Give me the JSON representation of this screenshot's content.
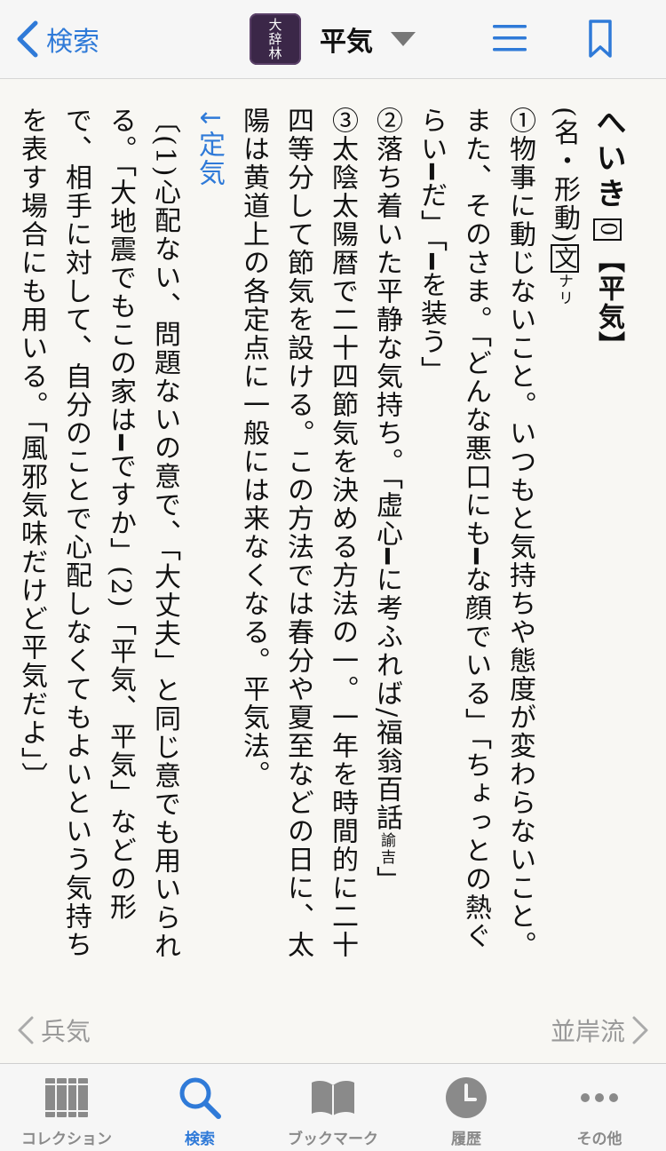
{
  "header": {
    "back_label": "検索",
    "app_badge": [
      "大",
      "辞",
      "林"
    ],
    "title": "平気"
  },
  "entry": {
    "headword": "へいき",
    "accent": "0",
    "kanji": "【平気】",
    "pos": "(名・形動)",
    "bun": "文",
    "nari": "ナリ",
    "s1_a": "①物事に動じないこと。いつもと気持ちや態度が変わらないこと。また、そのさま。「どんな悪口にも",
    "s1_b": "な顔でいる」「ちょっとの熱ぐらい",
    "s1_c": "だ」「",
    "s1_d": "を装う」",
    "s2_a": "②落ち着いた平静な気持ち。「虚心",
    "s2_b": "に考ふれば/福翁百話",
    "s2_small": "諭吉",
    "s2_c": "」",
    "s3": "③太陰太陽暦で二十四節気を決める方法の一。一年を時間的に二十四等分して節気を設ける。この方法では春分や夏至などの日に、太陽は黄道上の各定点に一般には来なくなる。平気法。",
    "see_arrow": "↓",
    "see_link": "定気",
    "note_a": "〔(1)心配ない、問題ないの意で、「大丈夫」と同じ意でも用いられる。「大地震でもこの家は",
    "note_b": "ですか」(2)「平気、平気」などの形で、相手に対して、自分のことで心配しなくてもよいという気持ちを表す場合にも用いる。「風邪気味だけど平気だよ」〕",
    "dash": "━"
  },
  "nav": {
    "prev": "兵気",
    "next": "並岸流"
  },
  "tabs": [
    {
      "label": "コレクション",
      "icon": "collection-icon"
    },
    {
      "label": "検索",
      "icon": "search-icon"
    },
    {
      "label": "ブックマーク",
      "icon": "book-icon"
    },
    {
      "label": "履歴",
      "icon": "clock-icon"
    },
    {
      "label": "その他",
      "icon": "more-icon"
    }
  ],
  "colors": {
    "accent": "#2f7ad8",
    "badge": "#3b2748",
    "inactive": "#8a8a8a"
  }
}
